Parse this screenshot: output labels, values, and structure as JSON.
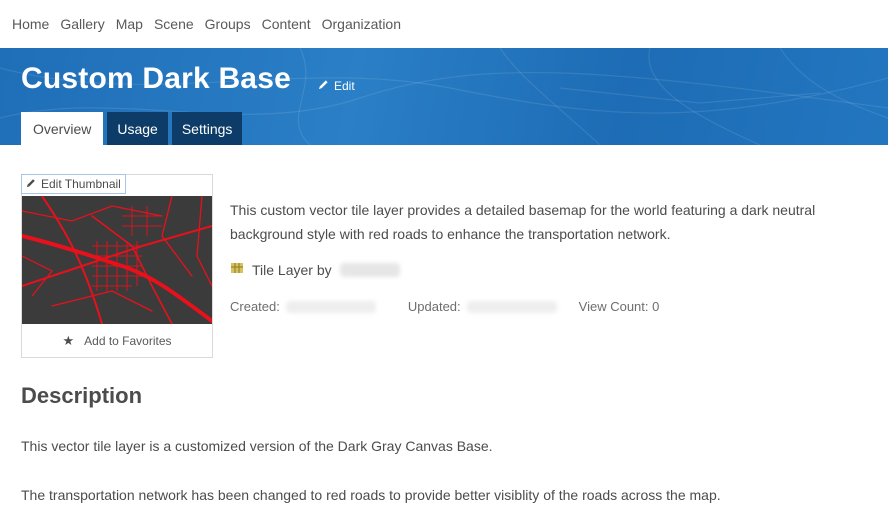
{
  "nav": {
    "items": [
      "Home",
      "Gallery",
      "Map",
      "Scene",
      "Groups",
      "Content",
      "Organization"
    ]
  },
  "header": {
    "title": "Custom Dark Base",
    "edit_label": "Edit",
    "tabs": [
      {
        "label": "Overview",
        "active": true
      },
      {
        "label": "Usage",
        "active": false
      },
      {
        "label": "Settings",
        "active": false
      }
    ],
    "banner_color": "#1f6eb8",
    "inactive_tab_color": "#0d3c68"
  },
  "thumbnail": {
    "edit_label": "Edit Thumbnail",
    "favorites_label": "Add to Favorites",
    "road_color": "#e8111b",
    "background_color": "#3b3b3b"
  },
  "summary": {
    "text": "This custom vector tile layer provides a detailed basemap for the world featuring a dark neutral background style with red roads to enhance the transportation network.",
    "type_label": "Tile Layer by",
    "created_label": "Created:",
    "updated_label": "Updated:",
    "view_count_label": "View Count: 0"
  },
  "description": {
    "title": "Description",
    "paragraphs": [
      "This vector tile layer is a customized version of the Dark Gray Canvas Base.",
      "The transportation network has been changed to red roads to provide better visiblity of the roads across the map."
    ]
  }
}
